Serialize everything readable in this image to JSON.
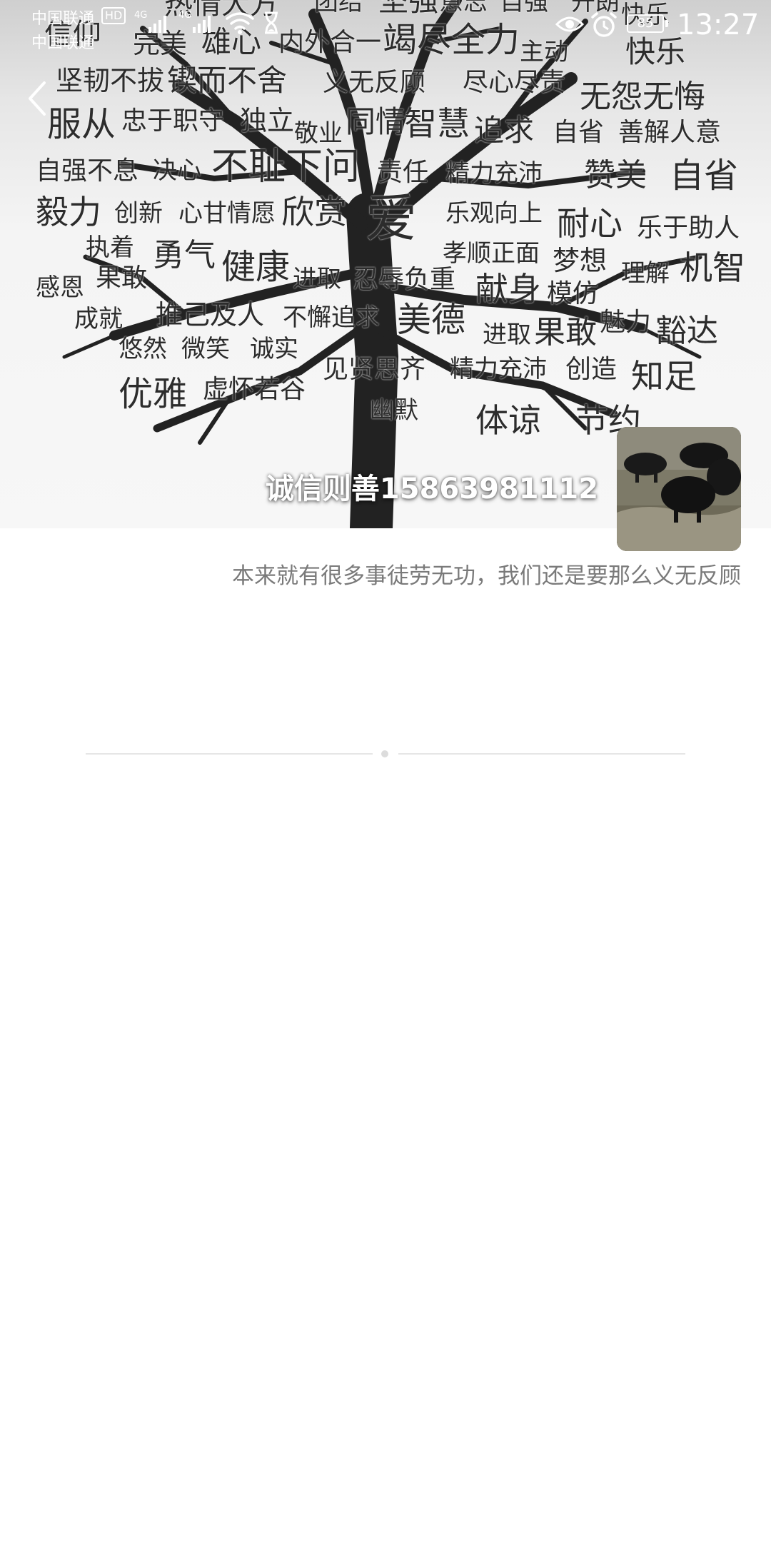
{
  "status_bar": {
    "carrier_1": "中国联通",
    "hd_badge": "HD",
    "network_1": "4G",
    "carrier_2": "中国联通",
    "network_2": "4G",
    "battery_level": "85",
    "time": "13:27"
  },
  "cover": {
    "words": [
      "信仰",
      "热情大方",
      "团结",
      "坚强",
      "意志",
      "自强",
      "开朗",
      "快乐",
      "完美",
      "雄心",
      "内外合一",
      "竭尽全力",
      "主动",
      "快乐",
      "坚韧不拔",
      "锲而不舍",
      "义无反顾",
      "尽心尽责",
      "服从",
      "忠于职守",
      "独立",
      "敬业",
      "同情",
      "智慧",
      "追求",
      "自省",
      "无怨无悔",
      "善解人意",
      "自强不息",
      "决心",
      "不耻下问",
      "责任",
      "精力充沛",
      "赞美",
      "自省",
      "毅力",
      "创新",
      "心甘情愿",
      "欣赏",
      "爱",
      "乐观向上",
      "耐心",
      "乐于助人",
      "执着",
      "勇气",
      "健康",
      "孝顺正面",
      "梦想",
      "理解",
      "机智",
      "感恩",
      "果敢",
      "进取",
      "忍辱负重",
      "献身",
      "模仿",
      "成就",
      "推己及人",
      "不懈追求",
      "美德",
      "进取",
      "果敢",
      "魅力",
      "豁达",
      "悠然",
      "微笑",
      "诚实",
      "见贤思齐",
      "精力充沛",
      "创造",
      "知足",
      "优雅",
      "虚怀若谷",
      "幽默",
      "体谅",
      "节约"
    ]
  },
  "profile": {
    "nickname": "诚信则善15863981112",
    "signature": "本来就有很多事徒劳无功，我们还是要那么义无反顾"
  },
  "colors": {
    "cover_text": "#2c2c2c",
    "signature_text": "#7a7a7a",
    "divider": "#e6e6e6"
  }
}
